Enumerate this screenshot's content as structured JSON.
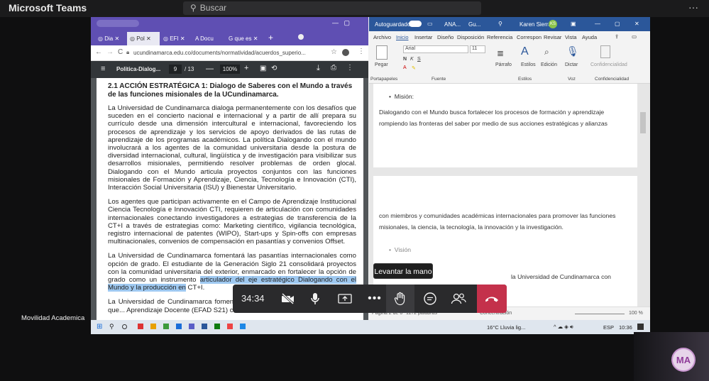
{
  "teams": {
    "app_title": "Microsoft Teams",
    "search_placeholder": "Buscar",
    "more": "···"
  },
  "chrome": {
    "tabs": [
      "Dia",
      "Pol",
      "EFI",
      "Docu",
      "que es"
    ],
    "address": "ucundinamarca.edu.co/documents/normatividad/acuerdos_superio...",
    "pdf_title": "Politica-Dialog...",
    "page_current": "9",
    "page_total": "/ 13",
    "zoom": "100%",
    "heading": "2.1 ACCIÓN ESTRATÉGICA 1: Dialogo de Saberes con el Mundo a través de las funciones misionales de la UCundinamarca.",
    "p1": "La Universidad de Cundinamarca dialoga permanentemente con los desafíos que suceden en el concierto nacional e internacional y a partir de allí prepara su currículo desde una dimensión intercultural e internacional, favoreciendo los procesos de aprendizaje y los servicios de apoyo derivados de las rutas de aprendizaje de los programas académicos. La política Dialogando con el mundo involucrará a los agentes de la comunidad universitaria desde la postura de diversidad internacional, cultural, lingüística y de investigación para visibilizar sus desarrollos misionales, permitiendo resolver problemas de orden glocal. Dialogando con el Mundo articula proyectos conjuntos con las funciones misionales de Formación y Aprendizaje, Ciencia, Tecnología e Innovación (CTI), Interacción Social Universitaria (ISU) y Bienestar Universitario.",
    "p2": "Los agentes que participan activamente en el Campo de Aprendizaje Institucional Ciencia Tecnología e Innovación CTI, requieren de articulación con comunidades internacionales conectando investigadores a estrategias de transferencia de la CT+I a través de estrategias como: Marketing científico, vigilancia tecnológica, registro internacional de patentes (WIPO), Start-ups y Spin-offs con empresas multinacionales, convenios de compensación en pasantías y convenios Offset.",
    "p3_a": "La Universidad de Cundinamarca fomentará las pasantías internacionales como opción de grado. El estudiante de la Generación Siglo 21 consolidará proyectos con la comunidad universitaria del exterior, enmarcado en fortalecer la opción de grado como un instrumento ",
    "p3_hl": "articulador del eje estratégico Dialogando con el Mundo y la producción en",
    "p3_b": " CT+I.",
    "p4": "La Universidad de Cundinamarca fomentará... profesores mediante los circuitos que... Aprendizaje Docente (EFAD S21) con..."
  },
  "word": {
    "autosave": "Autoguardado",
    "doc_name": "ANA...",
    "doc_name2": "Gu...",
    "user": "Karen Sierra",
    "user_initials": "KS",
    "menu": [
      "Archivo",
      "Inicio",
      "Insertar",
      "Diseño",
      "Disposición",
      "Referencia",
      "Correspon",
      "Revisar",
      "Vista",
      "Ayuda"
    ],
    "font": "Arial",
    "size": "11",
    "groups": [
      "Portapapeles",
      "Fuente",
      "Párrafo",
      "Estilos",
      "Edición",
      "Dictar",
      "Confidencialidad"
    ],
    "group_labels": [
      "Portapapeles",
      "Fuente",
      "Estilos",
      "Voz",
      "Confidencialidad"
    ],
    "paste": "Pegar",
    "bullet1": "Misión:",
    "text1": "Dialogando con el Mundo busca fortalecer los procesos de formación y aprendizaje rompiendo las fronteras del saber por medio de sus acciones estratégicas y alianzas",
    "text2": "con miembros y comunidades académicas internacionales para promover las funciones misionales, la ciencia, la tecnología, la innovación y la investigación.",
    "bullet2": "Visión",
    "text3": "la Universidad de Cundinamarca con",
    "status_page": "Página 2 de 6",
    "status_words": "1172 palabras",
    "status_focus": "Concentración",
    "status_zoom": "100 %"
  },
  "taskbar": {
    "weather": "16°C  Lluvia lig...",
    "lang": "ESP",
    "time": "10:36"
  },
  "meeting": {
    "timer": "34:34",
    "tooltip": "Levantar la mano",
    "participant_name": "Movilidad Academica",
    "self_initials": "MA"
  },
  "colors": {
    "teams_bg": "#0f0f10",
    "word_blue": "#2b579a",
    "chrome_purple": "#5f4fb3",
    "hangup": "#c4314b",
    "highlight": "#9fc9f1"
  }
}
